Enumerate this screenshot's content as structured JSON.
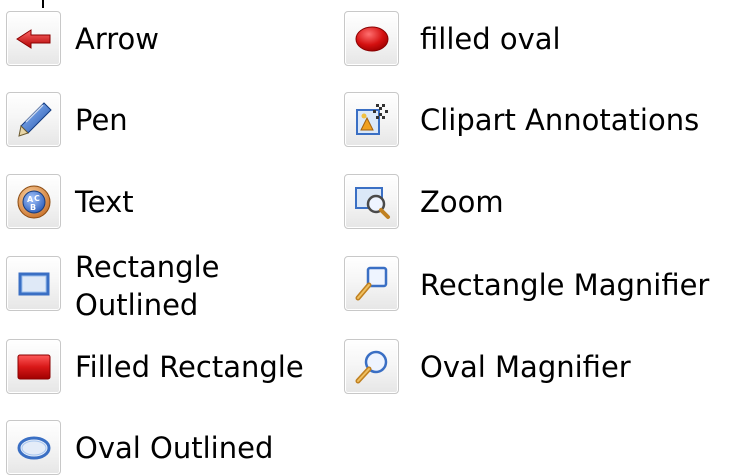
{
  "tools": {
    "arrow": {
      "label": "Arrow",
      "icon": "arrow-icon"
    },
    "pen": {
      "label": "Pen",
      "icon": "pen-icon"
    },
    "text": {
      "label": "Text",
      "icon": "text-abc-icon"
    },
    "rect_outlined": {
      "label_line1": "Rectangle",
      "label_line2": "Outlined",
      "icon": "rectangle-outline-icon"
    },
    "rect_filled": {
      "label": "Filled Rectangle",
      "icon": "filled-rectangle-icon"
    },
    "oval_outlined": {
      "label": "Oval Outlined",
      "icon": "oval-outline-icon"
    },
    "oval_filled": {
      "label": "filled oval",
      "icon": "filled-oval-icon"
    },
    "clipart": {
      "label": "Clipart Annotations",
      "icon": "clipart-icon"
    },
    "zoom": {
      "label": "Zoom",
      "icon": "zoom-icon"
    },
    "rect_magnifier": {
      "label": "Rectangle Magnifier",
      "icon": "rectangle-magnifier-icon"
    },
    "oval_magnifier": {
      "label": "Oval Magnifier",
      "icon": "oval-magnifier-icon"
    }
  },
  "colors": {
    "red": "#cc1010",
    "blue": "#3a6fc4",
    "button_border": "#c8c8c8"
  }
}
